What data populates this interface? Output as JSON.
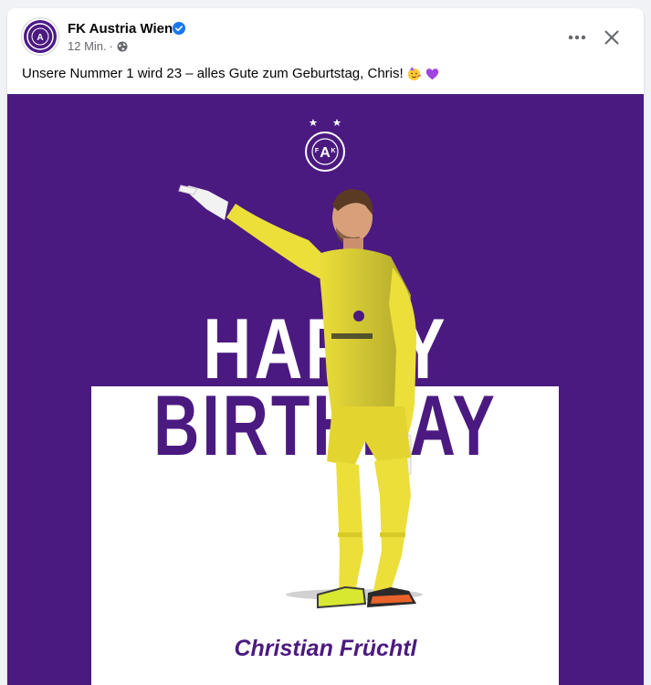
{
  "post": {
    "page_name": "FK Austria Wien",
    "time": "12 Min.",
    "separator": "·",
    "text": "Unsere Nummer 1 wird 23 – alles Gute zum Geburtstag, Chris!",
    "emojis": [
      "party-face-emoji",
      "purple-heart-emoji"
    ]
  },
  "image": {
    "headline_top": "HAPPY",
    "headline_bottom": "BIRTHDAY",
    "player_name": "Christian Früchtl",
    "crest_text": "FK AUSTRIA WIEN"
  },
  "icons": {
    "verified": "verified-badge-icon",
    "globe": "globe-icon",
    "more": "more-options-icon",
    "close": "close-icon"
  },
  "colors": {
    "brand_purple": "#4b1a80",
    "facebook_blue": "#1877f2",
    "text_primary": "#050505",
    "text_secondary": "#65676b",
    "background": "#f0f2f5"
  }
}
